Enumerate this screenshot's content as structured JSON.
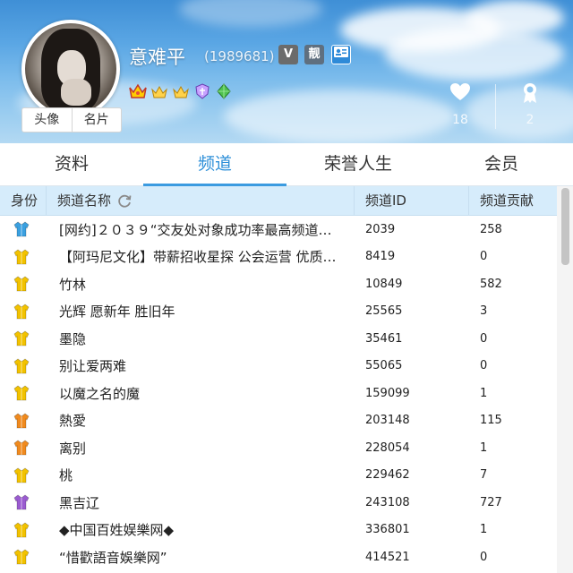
{
  "profile": {
    "name": "意难平",
    "id": "(1989681)",
    "badges": {
      "v": "V",
      "pretty": "靓",
      "card": "卡"
    },
    "avatar_tab": "头像",
    "card_tab": "名片"
  },
  "stats": {
    "likes": "18",
    "awards": "2"
  },
  "tabs": [
    "资料",
    "频道",
    "荣誉人生",
    "会员"
  ],
  "active_tab": "频道",
  "table": {
    "headers": {
      "role": "身份",
      "name": "频道名称",
      "id": "频道ID",
      "contribution": "频道贡献"
    },
    "rows": [
      {
        "role": "blue",
        "name": "[网约]２０３９“交友处对象成功率最高频道…",
        "id": "2039",
        "contribution": "258"
      },
      {
        "role": "yellow",
        "name": "【阿玛尼文化】带薪招收星探 公会运营 优质…",
        "id": "8419",
        "contribution": "0"
      },
      {
        "role": "yellow",
        "name": "竹林",
        "id": "10849",
        "contribution": "582"
      },
      {
        "role": "yellow",
        "name": "光辉 愿新年 胜旧年",
        "id": "25565",
        "contribution": "3"
      },
      {
        "role": "yellow",
        "name": "墨隐",
        "id": "35461",
        "contribution": "0"
      },
      {
        "role": "yellow",
        "name": "别让爱两难",
        "id": "55065",
        "contribution": "0"
      },
      {
        "role": "yellow",
        "name": "以魔之名的魔",
        "id": "159099",
        "contribution": "1"
      },
      {
        "role": "orange",
        "name": "熱愛",
        "id": "203148",
        "contribution": "115"
      },
      {
        "role": "orange",
        "name": "离别",
        "id": "228054",
        "contribution": "1"
      },
      {
        "role": "yellow",
        "name": "桃",
        "id": "229462",
        "contribution": "7"
      },
      {
        "role": "purple",
        "name": "黑吉辽",
        "id": "243108",
        "contribution": "727"
      },
      {
        "role": "yellow",
        "name": "◆中国百姓娱樂网◆",
        "id": "336801",
        "contribution": "1"
      },
      {
        "role": "yellow",
        "name": "“惜歡語音娛樂网”",
        "id": "414521",
        "contribution": "0"
      }
    ]
  },
  "colors": {
    "accent": "#2d8fd8",
    "header_bg": "#d6ecfb",
    "role_colors": {
      "blue": "#3aa0e0",
      "yellow": "#f2c200",
      "orange": "#f08a1e",
      "purple": "#9a5bd0"
    }
  }
}
